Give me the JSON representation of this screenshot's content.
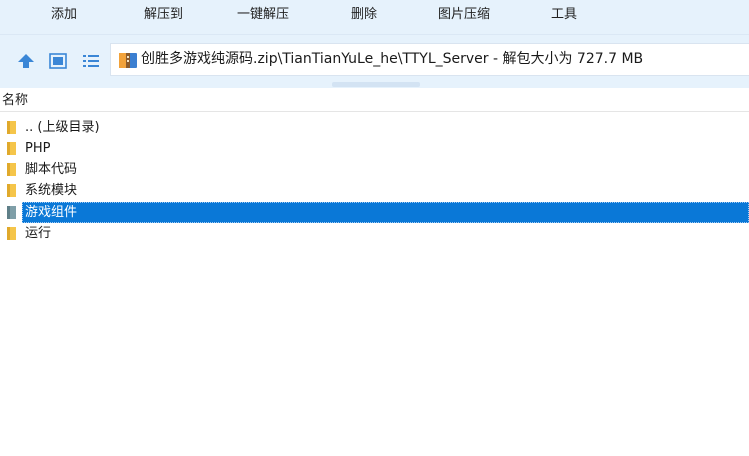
{
  "toolbar": {
    "add": "添加",
    "extract_to": "解压到",
    "one_click_extract": "一键解压",
    "delete": "删除",
    "image_compress": "图片压缩",
    "tools": "工具"
  },
  "nav": {
    "path": "创胜多游戏纯源码.zip\\TianTianYuLe_he\\TTYL_Server - 解包大小为 727.7 MB"
  },
  "columns": {
    "name": "名称"
  },
  "files": [
    {
      "name": ".. (上级目录)",
      "icon": "folder-icon",
      "selected": false
    },
    {
      "name": "PHP",
      "icon": "folder-icon",
      "selected": false
    },
    {
      "name": "脚本代码",
      "icon": "folder-icon",
      "selected": false
    },
    {
      "name": "系统模块",
      "icon": "folder-icon",
      "selected": false
    },
    {
      "name": "游戏组件",
      "icon": "folder-icon",
      "selected": true
    },
    {
      "name": "运行",
      "icon": "folder-icon",
      "selected": false
    }
  ],
  "colors": {
    "toolbar_bg": "#e6f2fc",
    "selection": "#0a78d7",
    "folder": "#f5c54a"
  }
}
